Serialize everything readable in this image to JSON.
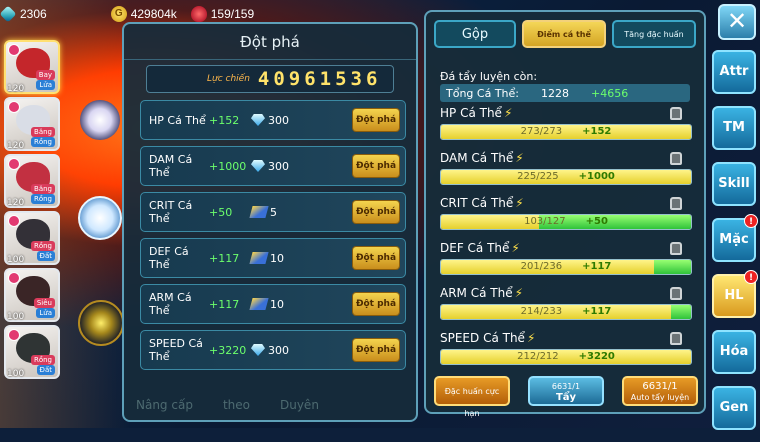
{
  "topbar": {
    "gems": "2306",
    "gold": "429804k",
    "stamina": "159/159",
    "gold_icon_letter": "G"
  },
  "monsters": [
    {
      "level": "120",
      "tag1": "Bay",
      "tag2": "Lửa",
      "color": "#c4262b"
    },
    {
      "level": "120",
      "tag1": "Băng",
      "tag2": "Rồng",
      "color": "#d9dde6"
    },
    {
      "level": "120",
      "tag1": "Băng",
      "tag2": "Rồng",
      "color": "#c23041"
    },
    {
      "level": "100",
      "tag1": "Rồng",
      "tag2": "Đất",
      "color": "#333037"
    },
    {
      "level": "100",
      "tag1": "Siêu",
      "tag2": "Lửa",
      "color": "#3a2526"
    },
    {
      "level": "100",
      "tag1": "Rồng",
      "tag2": "Đất",
      "color": "#2f3434"
    }
  ],
  "breakthrough": {
    "title": "Đột phá",
    "power_label": "Lực chiến",
    "power_value": "40961536",
    "button_label": "Đột phá",
    "rows": [
      {
        "name": "HP Cá Thể",
        "plus": "+152",
        "cost": "300",
        "cost_type": "diamond"
      },
      {
        "name": "DAM Cá Thể",
        "plus": "+1000",
        "cost": "300",
        "cost_type": "diamond"
      },
      {
        "name": "CRIT Cá Thể",
        "plus": "+50",
        "cost": "5",
        "cost_type": "stone"
      },
      {
        "name": "DEF Cá Thể",
        "plus": "+117",
        "cost": "10",
        "cost_type": "stone"
      },
      {
        "name": "ARM Cá Thể",
        "plus": "+117",
        "cost": "10",
        "cost_type": "stone"
      },
      {
        "name": "SPEED Cá Thể",
        "plus": "+3220",
        "cost": "300",
        "cost_type": "diamond"
      }
    ]
  },
  "bottom_menu": [
    "Nâng cấp",
    "theo",
    "Duyên"
  ],
  "individual": {
    "tabs": [
      "Gộp",
      "Điểm cá thể",
      "Tăng đặc huấn"
    ],
    "subtitle": "Đá tẩy luyện còn:",
    "total_label": "Tổng Cá Thể:",
    "total_value": "1228",
    "total_plus": "+4656",
    "stats": [
      {
        "name": "HP Cá Thể",
        "value": "273/273",
        "plus": "+152",
        "fill": 1.0,
        "green": 0.0
      },
      {
        "name": "DAM Cá Thể",
        "value": "225/225",
        "plus": "+1000",
        "fill": 1.0,
        "green": 0.0
      },
      {
        "name": "CRIT Cá Thể",
        "value": "103/127",
        "plus": "+50",
        "fill": 0.39,
        "green": 0.61
      },
      {
        "name": "DEF Cá Thể",
        "value": "201/236",
        "plus": "+117",
        "fill": 0.85,
        "green": 0.15
      },
      {
        "name": "ARM Cá Thể",
        "value": "214/233",
        "plus": "+117",
        "fill": 0.92,
        "green": 0.08
      },
      {
        "name": "SPEED Cá Thể",
        "value": "212/212",
        "plus": "+3220",
        "fill": 1.0,
        "green": 0.0
      }
    ],
    "actions": [
      {
        "label": "Đặc huấn cực hạn",
        "count": ""
      },
      {
        "label": "Tẩy",
        "count": "6631/1"
      },
      {
        "label": "Auto tẩy luyện",
        "count": "6631/1"
      }
    ]
  },
  "side_tabs": [
    {
      "label": "Attr",
      "badge": ""
    },
    {
      "label": "TM",
      "badge": ""
    },
    {
      "label": "Skill",
      "badge": ""
    },
    {
      "label": "Mặc",
      "badge": "!"
    },
    {
      "label": "HL",
      "badge": "!"
    },
    {
      "label": "Hóa",
      "badge": ""
    },
    {
      "label": "Gen",
      "badge": ""
    }
  ],
  "close_label": "✕"
}
